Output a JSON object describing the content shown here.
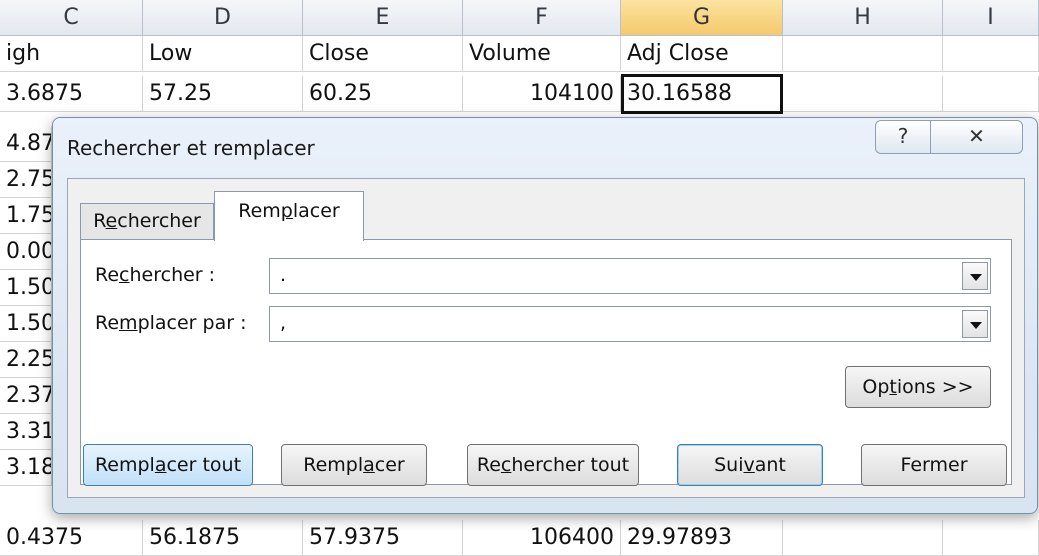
{
  "sheet": {
    "columns": [
      "C",
      "D",
      "E",
      "F",
      "G",
      "H",
      "I"
    ],
    "selected_column": "G",
    "header_row": [
      "igh",
      "Low",
      "Close",
      "Volume",
      "Adj Close",
      "",
      ""
    ],
    "row2": [
      "3.6875",
      "57.25",
      "60.25",
      "104100",
      "30.16588",
      "",
      ""
    ],
    "side_values": [
      "4.87",
      "2.75",
      "1.75",
      "0.00",
      "1.50",
      "1.50",
      "2.25",
      "2.37",
      "3.31",
      "3.18"
    ],
    "last_row": [
      "0.4375",
      "56.1875",
      "57.9375",
      "106400",
      "29.97893",
      "",
      ""
    ]
  },
  "dialog": {
    "title": "Rechercher et remplacer",
    "help_symbol": "?",
    "close_symbol": "✕",
    "tabs": {
      "find": {
        "pre": "R",
        "acc": "e",
        "post": "chercher"
      },
      "replace": {
        "pre": "Rem",
        "acc": "p",
        "post": "lacer"
      }
    },
    "find_label": {
      "pre": "Re",
      "acc": "c",
      "post": "hercher :"
    },
    "find_value": ".",
    "replace_label": {
      "pre": "Re",
      "acc": "m",
      "post": "placer par :"
    },
    "replace_value": ",",
    "options_button": {
      "pre": "Op",
      "acc": "t",
      "post": "ions >>"
    },
    "buttons": {
      "replace_all": {
        "pre": "Rempl",
        "acc": "a",
        "post": "cer tout"
      },
      "replace": {
        "pre": "Rempl",
        "acc": "a",
        "post": "cer"
      },
      "find_all": {
        "pre": "Re",
        "acc": "c",
        "post": "hercher tout"
      },
      "next": {
        "pre": "Sui",
        "acc": "v",
        "post": "ant"
      },
      "close": "Fermer"
    }
  }
}
